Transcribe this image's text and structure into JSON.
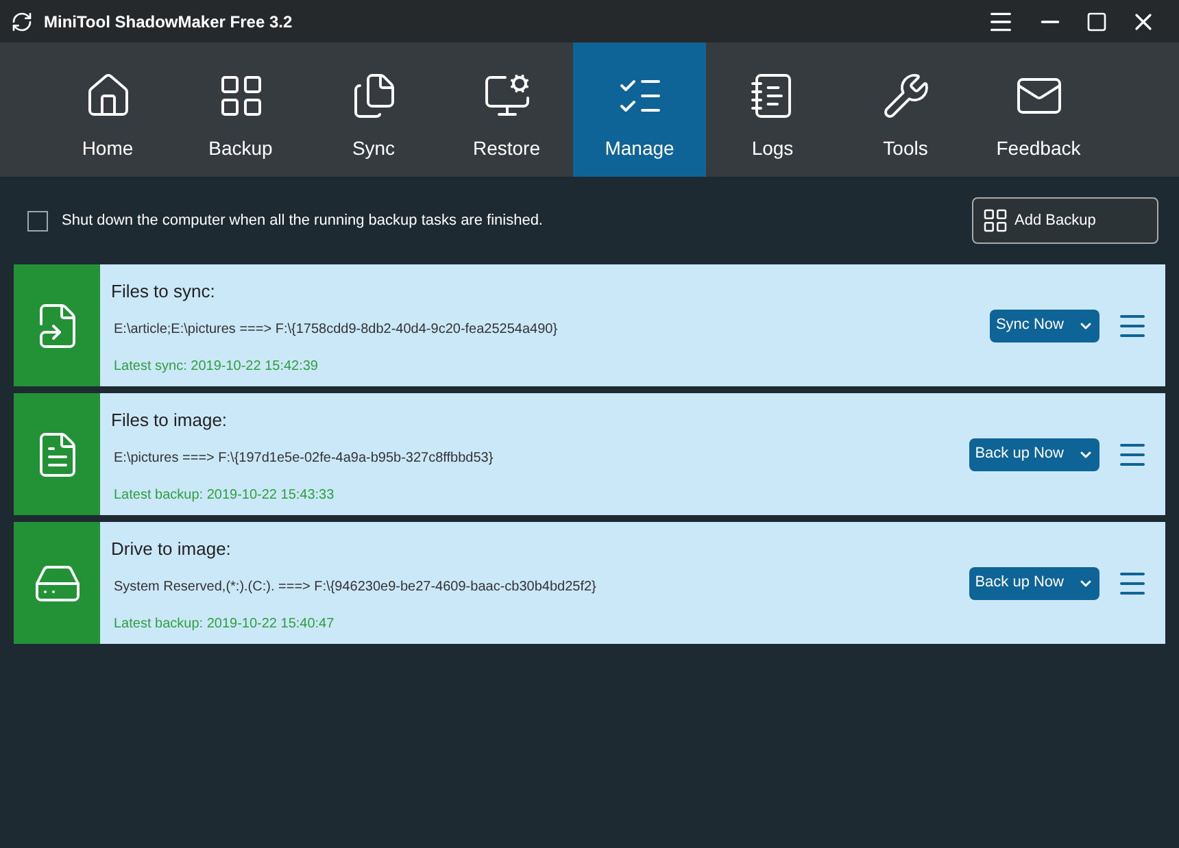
{
  "window": {
    "title": "MiniTool ShadowMaker Free 3.2"
  },
  "tabs": [
    {
      "label": "Home",
      "kind": "home",
      "selected": false
    },
    {
      "label": "Backup",
      "kind": "backup",
      "selected": false
    },
    {
      "label": "Sync",
      "kind": "sync",
      "selected": false
    },
    {
      "label": "Restore",
      "kind": "restore",
      "selected": false
    },
    {
      "label": "Manage",
      "kind": "manage",
      "selected": true
    },
    {
      "label": "Logs",
      "kind": "logs",
      "selected": false
    },
    {
      "label": "Tools",
      "kind": "tools",
      "selected": false
    },
    {
      "label": "Feedback",
      "kind": "feedback",
      "selected": false
    }
  ],
  "shutdown_option": {
    "label": "Shut down the computer when all the running backup tasks are finished.",
    "checked": false
  },
  "add_backup_button": "Add Backup",
  "tasks": [
    {
      "kind": "sync",
      "title": "Files to sync:",
      "path": "E:\\article;E:\\pictures ===> F:\\{1758cdd9-8db2-40d4-9c20-fea25254a490}",
      "status": "Latest sync: 2019-10-22 15:42:39",
      "action": "Sync Now"
    },
    {
      "kind": "files",
      "title": "Files to image:",
      "path": "E:\\pictures ===> F:\\{197d1e5e-02fe-4a9a-b95b-327c8ffbbd53}",
      "status": "Latest backup: 2019-10-22 15:43:33",
      "action": "Back up Now"
    },
    {
      "kind": "drive",
      "title": "Drive to image:",
      "path": "System Reserved,(*:).(C:). ===> F:\\{946230e9-be27-4609-baac-cb30b4bd25f2}",
      "status": "Latest backup: 2019-10-22 15:40:47",
      "action": "Back up Now"
    }
  ]
}
